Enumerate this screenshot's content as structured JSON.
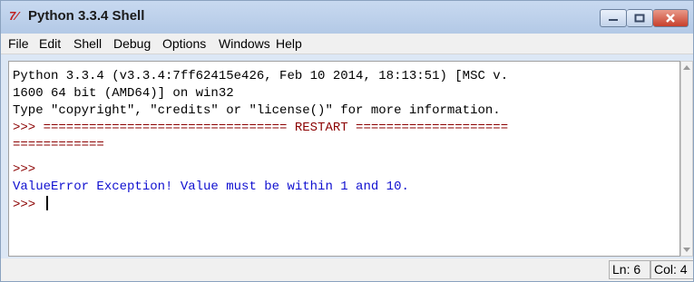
{
  "window": {
    "title": "Python 3.3.4 Shell",
    "icon_text": "7⁄"
  },
  "menu": {
    "items": [
      "File",
      "Edit",
      "Shell",
      "Debug",
      "Options",
      "Windows",
      "Help"
    ]
  },
  "shell": {
    "lines": [
      "Python 3.3.4 (v3.3.4:7ff62415e426, Feb 10 2014, 18:13:51) [MSC v.",
      "1600 64 bit (AMD64)] on win32",
      "Type \"copyright\", \"credits\" or \"license()\" for more information.",
      ">>> ================================ RESTART ====================",
      "============",
      ">>>",
      "ValueError Exception! Value must be within 1 and 10.",
      ">>> "
    ]
  },
  "status": {
    "ln": "Ln: 6",
    "col": "Col: 4"
  },
  "colors": {
    "prompt": "#8b0000",
    "error_text": "#1010d0",
    "titlebar": "#b3c9e6",
    "close": "#c7402c"
  },
  "icons": {
    "minimize": "minimize-icon",
    "maximize": "maximize-icon",
    "close": "close-icon",
    "app": "idle-icon"
  }
}
